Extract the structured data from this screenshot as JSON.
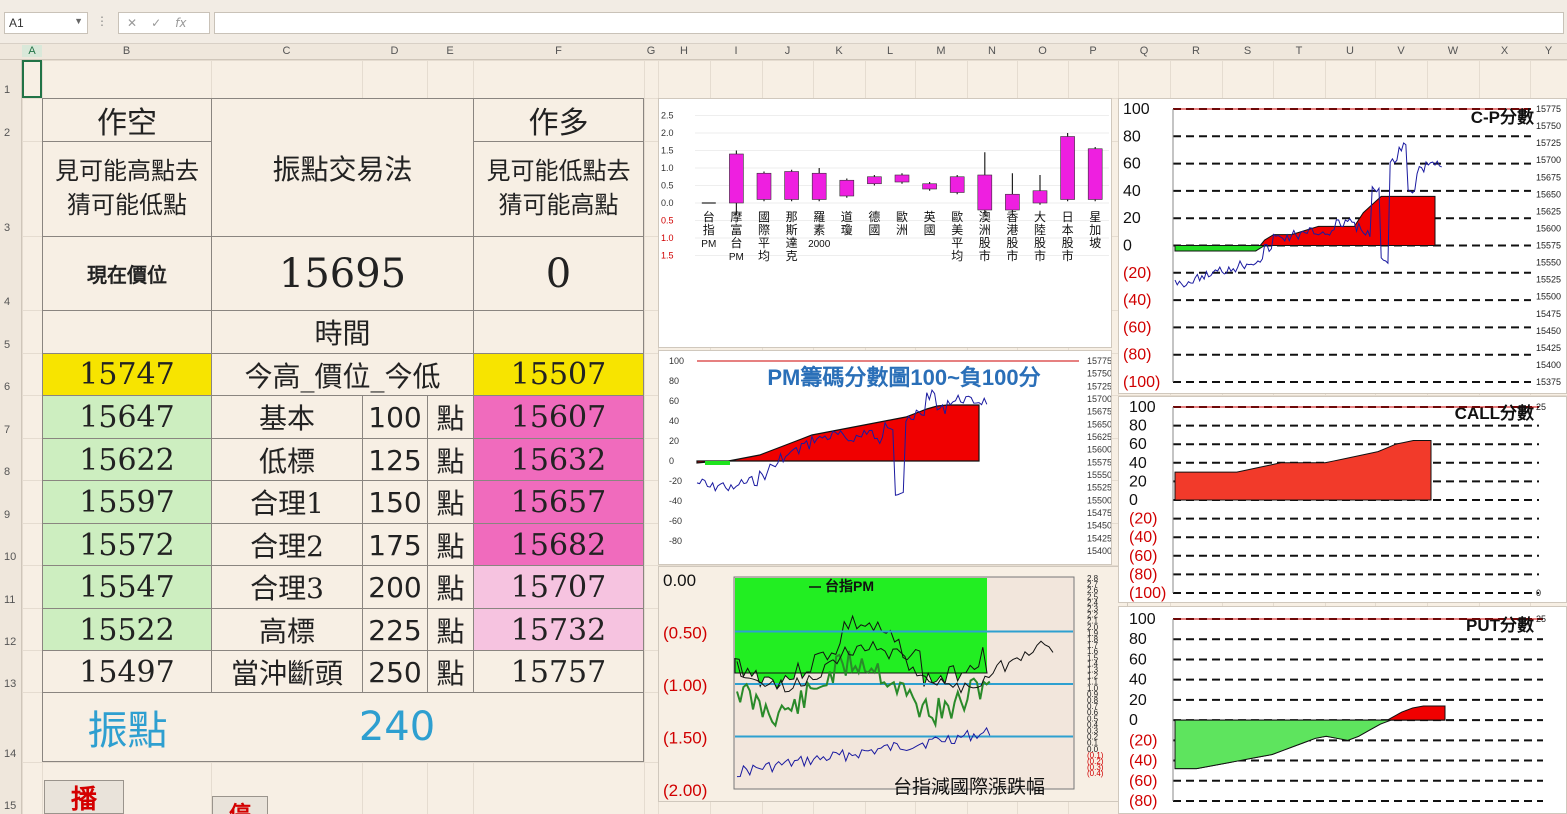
{
  "formula_bar": {
    "name_box": "A1",
    "icons": [
      "cancel-icon",
      "confirm-icon",
      "function-icon"
    ],
    "value": ""
  },
  "columns": [
    "A",
    "B",
    "C",
    "D",
    "E",
    "F",
    "G",
    "H",
    "I",
    "J",
    "K",
    "L",
    "M",
    "N",
    "O",
    "P",
    "Q",
    "R",
    "S",
    "T",
    "U",
    "V",
    "W",
    "X",
    "Y"
  ],
  "rows": [
    "1",
    "2",
    "3",
    "4",
    "5",
    "6",
    "7",
    "8",
    "9",
    "10",
    "11",
    "12",
    "13",
    "14",
    "15"
  ],
  "table": {
    "short_title": "作空",
    "short_desc": "見可能高點去猜可能低點",
    "method": "振點交易法",
    "long_title": "作多",
    "long_desc": "見可能低點去猜可能高點",
    "current_label": "現在價位",
    "current_price": "15695",
    "current_right": "0",
    "time_label": "時間",
    "high_value": "15747",
    "high_low_label": "今高_價位_今低",
    "low_value": "15507",
    "levels": [
      {
        "left": "15647",
        "label": "基本",
        "points": "100",
        "unit": "點",
        "right": "15607"
      },
      {
        "left": "15622",
        "label": "低標",
        "points": "125",
        "unit": "點",
        "right": "15632"
      },
      {
        "left": "15597",
        "label": "合理1",
        "points": "150",
        "unit": "點",
        "right": "15657"
      },
      {
        "left": "15572",
        "label": "合理2",
        "points": "175",
        "unit": "點",
        "right": "15682"
      },
      {
        "left": "15547",
        "label": "合理3",
        "points": "200",
        "unit": "點",
        "right": "15707"
      },
      {
        "left": "15522",
        "label": "高標",
        "points": "225",
        "unit": "點",
        "right": "15732"
      },
      {
        "left": "15497",
        "label": "當沖斷頭",
        "points": "250",
        "unit": "點",
        "right": "15757"
      }
    ],
    "swing_label": "振點",
    "swing_value": "240"
  },
  "buttons": {
    "play": "播",
    "stop": "停"
  },
  "colors": {
    "yellow": "#f7e400",
    "green": "#cdeec0",
    "pink_strong": "#f06bbd",
    "pink_light": "#f6c3e0",
    "accent_blue": "#2e9fd0",
    "red": "#f00000",
    "magenta": "#ee1fe0",
    "lime": "#1ee41e"
  },
  "chart_data": [
    {
      "type": "bar",
      "title": "",
      "categories": [
        "台指PM",
        "摩富台PM",
        "國際平均",
        "那斯達克",
        "羅素2000",
        "道瓊",
        "德國",
        "歐洲",
        "英國",
        "歐美平均",
        "澳洲股市",
        "香港股市",
        "大陸股市",
        "日本股市",
        "星加坡"
      ],
      "open": [
        0,
        1.4,
        0.1,
        0.1,
        0.1,
        0.2,
        0.55,
        0.6,
        0.4,
        0.3,
        -0.2,
        -0.2,
        0.0,
        0.1,
        0.1
      ],
      "close": [
        0,
        0.0,
        0.85,
        0.9,
        0.85,
        0.65,
        0.75,
        0.8,
        0.55,
        0.75,
        0.8,
        0.25,
        0.35,
        1.9,
        1.55
      ],
      "high": [
        0,
        1.5,
        0.9,
        0.95,
        1.0,
        0.7,
        0.8,
        0.85,
        0.6,
        0.8,
        1.45,
        0.85,
        0.8,
        2.0,
        1.6
      ],
      "low": [
        0,
        -0.35,
        0.05,
        0.05,
        0.05,
        0.15,
        0.5,
        0.55,
        0.35,
        0.25,
        -0.35,
        -0.25,
        -0.05,
        0.05,
        0.05
      ],
      "y_ticks_positive": [
        "2.5",
        "2.0",
        "1.5",
        "1.0",
        "0.5",
        "0.0"
      ],
      "y_ticks_negative": [
        "0.5",
        "1.0",
        "1.5"
      ],
      "ylim": [
        -1.5,
        2.5
      ]
    },
    {
      "type": "area",
      "title": "PM籌碼分數圖100~負100分",
      "y_ticks_left": [
        "100",
        "80",
        "60",
        "40",
        "20",
        "0",
        "-20",
        "-40",
        "-60",
        "-80"
      ],
      "y_ticks_right": [
        "15775",
        "15750",
        "15725",
        "15700",
        "15675",
        "15650",
        "15625",
        "15600",
        "15575",
        "15550",
        "15525",
        "15500",
        "15475",
        "15450",
        "15425",
        "15400"
      ],
      "area_values": [
        -2,
        -1,
        -3,
        0,
        2,
        4,
        6,
        10,
        14,
        18,
        22,
        26,
        28,
        30,
        32,
        34,
        36,
        38,
        40,
        42,
        44,
        48,
        52,
        55,
        56,
        56,
        56,
        56
      ],
      "price_values": [
        -22,
        -26,
        -24,
        -28,
        -22,
        -20,
        -14,
        -4,
        4,
        10,
        16,
        22,
        24,
        26,
        22,
        24,
        30,
        20,
        36,
        -30,
        40,
        48,
        66,
        52,
        60,
        62,
        60,
        60
      ],
      "ylim": [
        -90,
        100
      ]
    },
    {
      "type": "line",
      "title": "",
      "legend": "台指PM",
      "annotation": "台指減國際漲跌幅",
      "y_ticks_left": [
        "0.00",
        "(0.50)",
        "(1.00)",
        "(1.50)",
        "(2.00)"
      ],
      "y_ticks_right": [
        "2.8",
        "2.7",
        "2.6",
        "2.5",
        "2.4",
        "2.3",
        "2.2",
        "2.1",
        "2.0",
        "1.9",
        "1.8",
        "1.7",
        "1.6",
        "1.5",
        "1.4",
        "1.3",
        "1.2",
        "1.1",
        "1.0",
        "0.9",
        "0.8",
        "0.7",
        "0.6",
        "0.5",
        "0.4",
        "0.3",
        "0.2",
        "0.1",
        "0.0"
      ],
      "y_ticks_right_neg": [
        "(0.1)",
        "(0.2)",
        "(0.3)",
        "(0.4)"
      ],
      "ylim": [
        -2.0,
        0.0
      ]
    },
    {
      "type": "area",
      "title": "C-P分數",
      "y_ticks_left": [
        "100",
        "80",
        "60",
        "40",
        "20",
        "0",
        "(20)",
        "(40)",
        "(60)",
        "(80)",
        "(100)"
      ],
      "y_ticks_right": [
        "15775",
        "15750",
        "15725",
        "15700",
        "15675",
        "15650",
        "15625",
        "15600",
        "15575",
        "15550",
        "15525",
        "15500",
        "15475",
        "15450",
        "15425",
        "15400",
        "15375"
      ],
      "area_values": [
        -4,
        -4,
        -4,
        -4,
        -4,
        -4,
        -4,
        -4,
        -4,
        -4,
        4,
        8,
        8,
        8,
        10,
        12,
        14,
        14,
        14,
        14,
        14,
        24,
        30,
        36,
        36,
        36,
        36,
        36,
        36,
        36
      ],
      "price_values": [
        -26,
        -30,
        -24,
        -22,
        -20,
        -18,
        -16,
        -14,
        -12,
        -10,
        -2,
        6,
        6,
        8,
        8,
        10,
        10,
        10,
        16,
        18,
        14,
        8,
        40,
        -12,
        60,
        72,
        40,
        56,
        60,
        60
      ],
      "ylim": [
        -100,
        100
      ]
    },
    {
      "type": "area",
      "title": "CALL分數",
      "y_ticks_left": [
        "100",
        "80",
        "60",
        "40",
        "20",
        "0",
        "(20)",
        "(40)",
        "(60)",
        "(80)",
        "(100)"
      ],
      "y_ticks_right": [
        "25",
        "0"
      ],
      "area_values": [
        30,
        30,
        30,
        30,
        30,
        30,
        30,
        30,
        32,
        34,
        36,
        38,
        40,
        40,
        40,
        40,
        40,
        40,
        42,
        44,
        46,
        48,
        50,
        52,
        56,
        60,
        62,
        64,
        64,
        64
      ],
      "ylim": [
        -100,
        100
      ]
    },
    {
      "type": "area",
      "title": "PUT分數",
      "y_ticks_left": [
        "100",
        "80",
        "60",
        "40",
        "20",
        "0",
        "(20)",
        "(40)",
        "(60)",
        "(80)"
      ],
      "y_ticks_right": [
        "25"
      ],
      "area_values": [
        -48,
        -48,
        -48,
        -46,
        -44,
        -42,
        -40,
        -38,
        -36,
        -34,
        -30,
        -26,
        -22,
        -18,
        -16,
        -18,
        -20,
        -16,
        -10,
        -4,
        2,
        8,
        12,
        14,
        14,
        14
      ],
      "ylim": [
        -80,
        100
      ]
    }
  ]
}
